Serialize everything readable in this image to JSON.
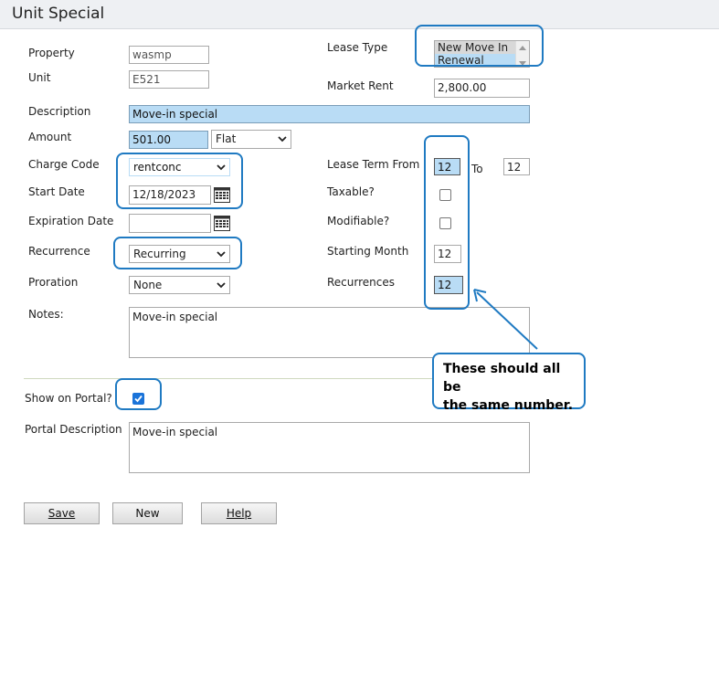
{
  "window": {
    "title": "Unit Special"
  },
  "form": {
    "property": {
      "label": "Property",
      "value": "wasmp"
    },
    "unit": {
      "label": "Unit",
      "value": "E521"
    },
    "lease_type": {
      "label": "Lease Type",
      "options": [
        "New Move In",
        "Renewal"
      ]
    },
    "market_rent": {
      "label": "Market Rent",
      "value": "2,800.00"
    },
    "description": {
      "label": "Description",
      "value": "Move-in special"
    },
    "amount": {
      "label": "Amount",
      "value": "501.00",
      "type_value": "Flat"
    },
    "charge_code": {
      "label": "Charge Code",
      "value": "rentconc"
    },
    "lease_term": {
      "label": "Lease Term From",
      "from": "12",
      "to_label": "To",
      "to": "12"
    },
    "start_date": {
      "label": "Start Date",
      "value": "12/18/2023"
    },
    "taxable": {
      "label": "Taxable?",
      "checked": false
    },
    "expiration_date": {
      "label": "Expiration Date",
      "value": ""
    },
    "modifiable": {
      "label": "Modifiable?",
      "checked": false
    },
    "recurrence": {
      "label": "Recurrence",
      "value": "Recurring"
    },
    "starting_month": {
      "label": "Starting Month",
      "value": "12"
    },
    "proration": {
      "label": "Proration",
      "value": "None"
    },
    "recurrences": {
      "label": "Recurrences",
      "value": "12"
    },
    "notes": {
      "label": "Notes:",
      "value": "Move-in special"
    },
    "show_on_portal": {
      "label": "Show on Portal?",
      "checked": true
    },
    "portal_description": {
      "label": "Portal Description",
      "value": "Move-in special"
    }
  },
  "buttons": {
    "save": "Save",
    "new": "New",
    "help": "Help"
  },
  "annotation": {
    "line1": "These should all be",
    "line2": "the same number."
  },
  "colors": {
    "highlight": "#b9dcf5",
    "callout_border": "#1f7ac2",
    "checkbox_checked": "#1a73d9"
  },
  "icons": {
    "calendar": "calendar-icon",
    "dropdown": "chevron-down-icon",
    "check": "checkmark-icon",
    "arrow": "arrow-icon"
  }
}
